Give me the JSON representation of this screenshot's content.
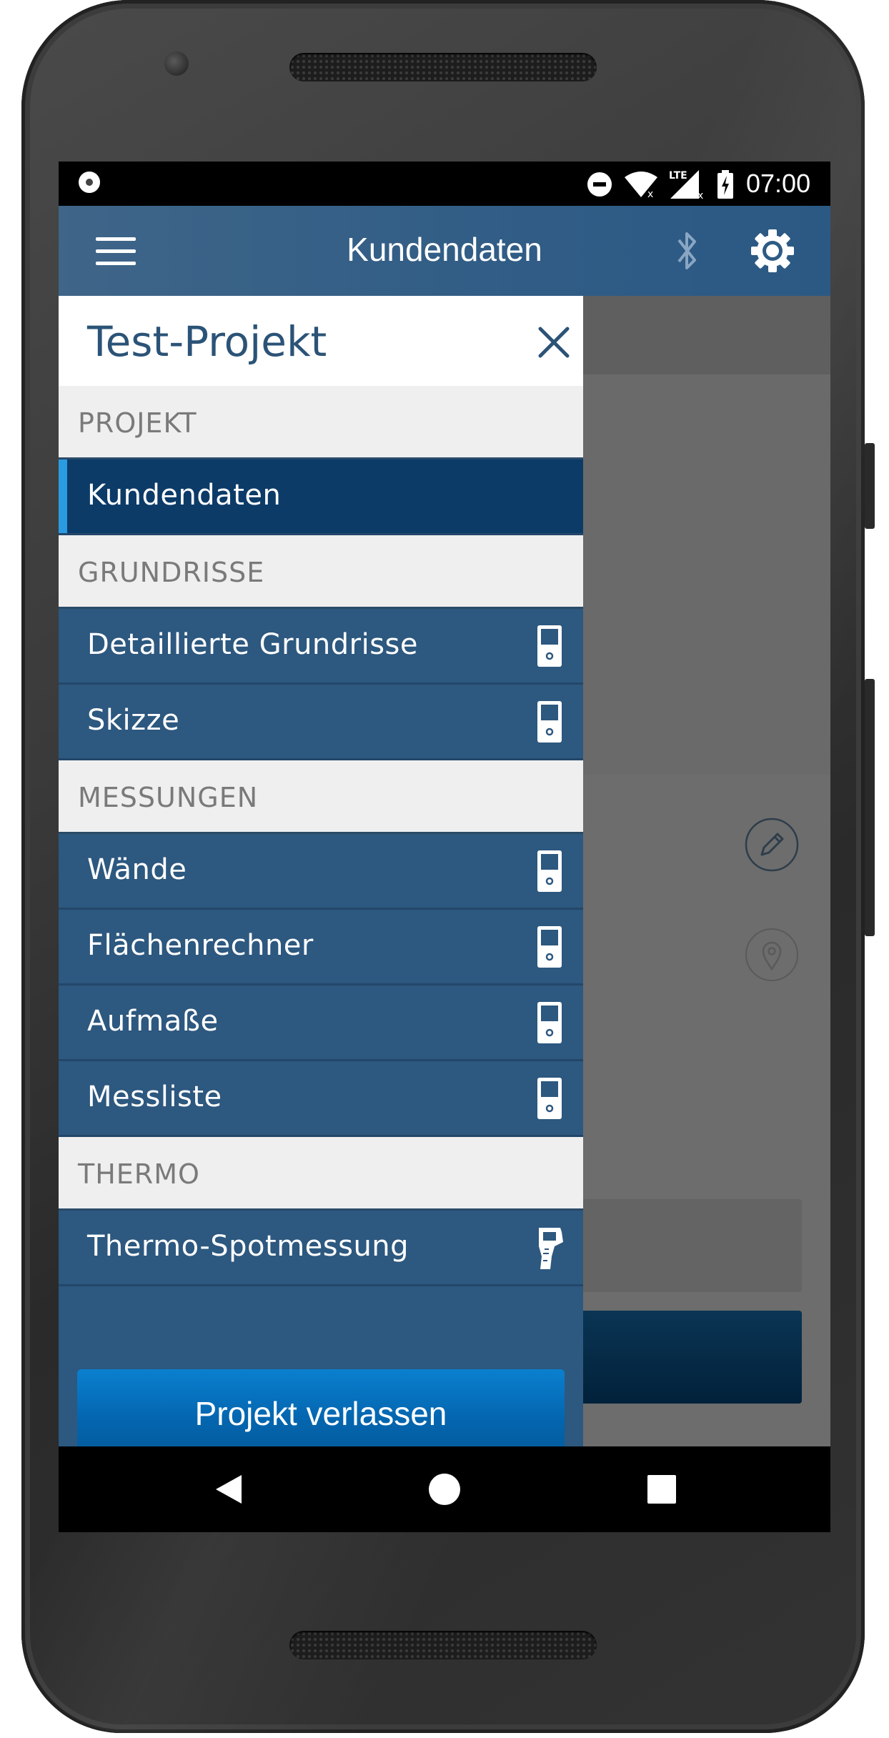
{
  "status_bar": {
    "time": "07:00",
    "network": "LTE"
  },
  "app_bar": {
    "title": "Kundendaten"
  },
  "drawer": {
    "project_title": "Test-Projekt",
    "sections": [
      {
        "title": "PROJEKT",
        "items": [
          {
            "label": "Kundendaten",
            "active": true,
            "icon": null
          }
        ]
      },
      {
        "title": "GRUNDRISSE",
        "items": [
          {
            "label": "Detaillierte Grundrisse",
            "icon": "laser-device-icon"
          },
          {
            "label": "Skizze",
            "icon": "laser-device-icon"
          }
        ]
      },
      {
        "title": "MESSUNGEN",
        "items": [
          {
            "label": "Wände",
            "icon": "laser-device-icon"
          },
          {
            "label": "Flächenrechner",
            "icon": "laser-device-icon"
          },
          {
            "label": "Aufmaße",
            "icon": "laser-device-icon"
          },
          {
            "label": "Messliste",
            "icon": "laser-device-icon"
          }
        ]
      },
      {
        "title": "THERMO",
        "items": [
          {
            "label": "Thermo-Spotmessung",
            "icon": "thermo-device-icon"
          }
        ]
      }
    ],
    "footer_button": "Projekt verlassen"
  },
  "colors": {
    "app_bar": "#315d86",
    "drawer_item": "#2d587f",
    "active_item": "#0c3b68",
    "active_indicator": "#2a9be0",
    "section_bg": "#efefef",
    "button": "#0466b0"
  }
}
